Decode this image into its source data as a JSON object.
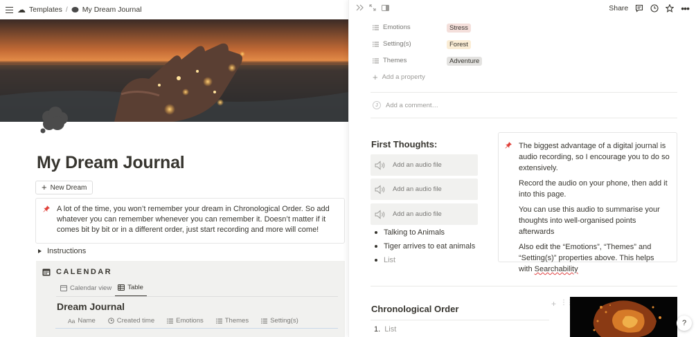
{
  "breadcrumb": {
    "templates": "Templates",
    "separator": "/",
    "page": "My Dream Journal"
  },
  "page": {
    "title": "My Dream Journal",
    "new_button": "New Dream",
    "callout": "A lot of the time, you won’t remember your dream in Chronological Order. So add whatever you can remember whenever you can remember it. Doesn’t matter if it comes bit by bit or in a different order, just start recording and more will come!",
    "toggle_label": "Instructions"
  },
  "calendar": {
    "heading": "CALENDAR",
    "views": [
      "Calendar view",
      "Table"
    ],
    "db_title": "Dream Journal",
    "columns": [
      "Name",
      "Created time",
      "Emotions",
      "Themes",
      "Setting(s)"
    ],
    "name_col_prefix": "Aa"
  },
  "side_peek": {
    "share_label": "Share",
    "properties": [
      {
        "label": "Emotions",
        "value": "Stress",
        "color": "#f4dfdb"
      },
      {
        "label": "Setting(s)",
        "value": "Forest",
        "color": "#fbedd5"
      },
      {
        "label": "Themes",
        "value": "Adventure",
        "color": "#e3e2e0"
      }
    ],
    "add_property": "Add a property",
    "add_comment": "Add a comment…",
    "first_thoughts": "First Thoughts:",
    "audio_placeholder": "Add an audio file",
    "audio_items": [
      "Add an audio file",
      "Add an audio file",
      "Add an audio file"
    ],
    "bullets": [
      "Talking to Animals",
      "Tiger arrives to eat animals"
    ],
    "bullet_placeholder": "List",
    "callout_paragraphs": [
      "The biggest advantage of a digital journal is audio recording, so I encourage you to do so extensively.",
      "Record the audio on your phone, then add it into this page.",
      "You can use this audio to summarise your thoughts into well-organised points afterwards",
      "Also edit the “Emotions”, “Themes” and “Setting(s)” properties above. This helps with"
    ],
    "callout_last_word": "Searchability",
    "chrono_heading": "Chronological Order",
    "numbered_prefix": "1.",
    "numbered_placeholder": "List",
    "help_label": "?"
  },
  "icons": [
    "menu-icon",
    "templates-icon",
    "page-icon",
    "plus-icon",
    "pin-icon",
    "calendar-icon",
    "table-icon",
    "list-property-icon",
    "speaker-icon",
    "comment-icon",
    "clock-icon",
    "star-icon",
    "more-icon",
    "expand-icon",
    "close-peek-icon",
    "drag-handle-icon"
  ],
  "colors": {
    "accent_text": "#37352f",
    "muted": "#787774",
    "placeholder": "#9b9a97",
    "callout_border": "#e5e5e5",
    "db_bg": "#f1f1ef"
  }
}
